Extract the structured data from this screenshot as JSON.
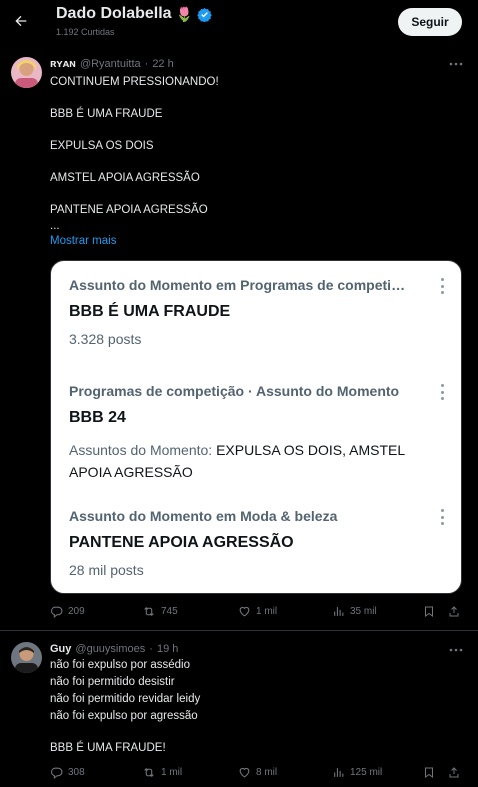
{
  "header": {
    "name": "Dado Dolabella",
    "emoji": "🌷",
    "likes_count": "1.192 Curtidas",
    "follow_label": "Seguir"
  },
  "tweet1": {
    "author": "ʀʏᴀɴ",
    "handle": "@Ryantuitta",
    "dot": "·",
    "time": "22 h",
    "lines": [
      "CONTINUEM PRESSIONANDO!",
      "BBB É UMA FRAUDE",
      "EXPULSA OS DOIS",
      "AMSTEL APOIA AGRESSÃO",
      "PANTENE APOIA AGRESSÃO",
      "..."
    ],
    "show_more": "Mostrar mais",
    "trends": [
      {
        "category": "Assunto do Momento em Programas de competição",
        "name": "BBB É UMA FRAUDE",
        "count": "3.328 posts"
      },
      {
        "category": "Programas de competição · Assunto do Momento",
        "name": "BBB 24",
        "related_label": "Assuntos do Momento: ",
        "related_text": "EXPULSA OS DOIS, AMSTEL APOIA AGRESSÃO"
      },
      {
        "category": "Assunto do Momento em Moda & beleza",
        "name": "PANTENE APOIA AGRESSÃO",
        "count": "28 mil posts"
      }
    ],
    "actions": {
      "replies": "209",
      "reposts": "745",
      "likes": "1 mil",
      "views": "35 mil"
    }
  },
  "tweet2": {
    "author": "Guy",
    "handle": "@guuysimoes",
    "dot": "·",
    "time": "19 h",
    "lines": [
      "não foi expulso por assédio",
      "não foi permitido desistir",
      "não foi permitido revidar leidy",
      "não foi expulso por agressão",
      "BBB É UMA FRAUDE!"
    ],
    "actions": {
      "replies": "308",
      "reposts": "1 mil",
      "likes": "8 mil",
      "views": "125 mil"
    }
  },
  "colors": {
    "background": "#000000",
    "link": "#1d9bf0",
    "verified": "#1d9bf0",
    "muted": "#71767b"
  }
}
